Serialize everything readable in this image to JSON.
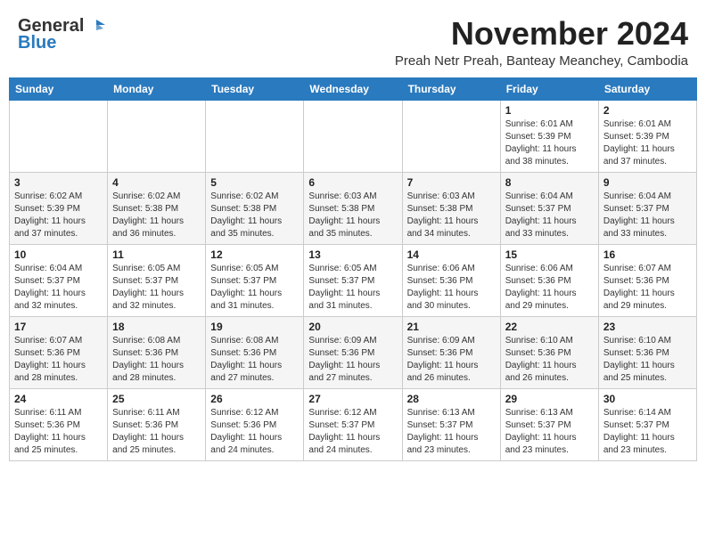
{
  "header": {
    "logo_line1": "General",
    "logo_line2": "Blue",
    "month": "November 2024",
    "subtitle": "Preah Netr Preah, Banteay Meanchey, Cambodia"
  },
  "weekdays": [
    "Sunday",
    "Monday",
    "Tuesday",
    "Wednesday",
    "Thursday",
    "Friday",
    "Saturday"
  ],
  "weeks": [
    [
      {
        "day": "",
        "info": ""
      },
      {
        "day": "",
        "info": ""
      },
      {
        "day": "",
        "info": ""
      },
      {
        "day": "",
        "info": ""
      },
      {
        "day": "",
        "info": ""
      },
      {
        "day": "1",
        "info": "Sunrise: 6:01 AM\nSunset: 5:39 PM\nDaylight: 11 hours and 38 minutes."
      },
      {
        "day": "2",
        "info": "Sunrise: 6:01 AM\nSunset: 5:39 PM\nDaylight: 11 hours and 37 minutes."
      }
    ],
    [
      {
        "day": "3",
        "info": "Sunrise: 6:02 AM\nSunset: 5:39 PM\nDaylight: 11 hours and 37 minutes."
      },
      {
        "day": "4",
        "info": "Sunrise: 6:02 AM\nSunset: 5:38 PM\nDaylight: 11 hours and 36 minutes."
      },
      {
        "day": "5",
        "info": "Sunrise: 6:02 AM\nSunset: 5:38 PM\nDaylight: 11 hours and 35 minutes."
      },
      {
        "day": "6",
        "info": "Sunrise: 6:03 AM\nSunset: 5:38 PM\nDaylight: 11 hours and 35 minutes."
      },
      {
        "day": "7",
        "info": "Sunrise: 6:03 AM\nSunset: 5:38 PM\nDaylight: 11 hours and 34 minutes."
      },
      {
        "day": "8",
        "info": "Sunrise: 6:04 AM\nSunset: 5:37 PM\nDaylight: 11 hours and 33 minutes."
      },
      {
        "day": "9",
        "info": "Sunrise: 6:04 AM\nSunset: 5:37 PM\nDaylight: 11 hours and 33 minutes."
      }
    ],
    [
      {
        "day": "10",
        "info": "Sunrise: 6:04 AM\nSunset: 5:37 PM\nDaylight: 11 hours and 32 minutes."
      },
      {
        "day": "11",
        "info": "Sunrise: 6:05 AM\nSunset: 5:37 PM\nDaylight: 11 hours and 32 minutes."
      },
      {
        "day": "12",
        "info": "Sunrise: 6:05 AM\nSunset: 5:37 PM\nDaylight: 11 hours and 31 minutes."
      },
      {
        "day": "13",
        "info": "Sunrise: 6:05 AM\nSunset: 5:37 PM\nDaylight: 11 hours and 31 minutes."
      },
      {
        "day": "14",
        "info": "Sunrise: 6:06 AM\nSunset: 5:36 PM\nDaylight: 11 hours and 30 minutes."
      },
      {
        "day": "15",
        "info": "Sunrise: 6:06 AM\nSunset: 5:36 PM\nDaylight: 11 hours and 29 minutes."
      },
      {
        "day": "16",
        "info": "Sunrise: 6:07 AM\nSunset: 5:36 PM\nDaylight: 11 hours and 29 minutes."
      }
    ],
    [
      {
        "day": "17",
        "info": "Sunrise: 6:07 AM\nSunset: 5:36 PM\nDaylight: 11 hours and 28 minutes."
      },
      {
        "day": "18",
        "info": "Sunrise: 6:08 AM\nSunset: 5:36 PM\nDaylight: 11 hours and 28 minutes."
      },
      {
        "day": "19",
        "info": "Sunrise: 6:08 AM\nSunset: 5:36 PM\nDaylight: 11 hours and 27 minutes."
      },
      {
        "day": "20",
        "info": "Sunrise: 6:09 AM\nSunset: 5:36 PM\nDaylight: 11 hours and 27 minutes."
      },
      {
        "day": "21",
        "info": "Sunrise: 6:09 AM\nSunset: 5:36 PM\nDaylight: 11 hours and 26 minutes."
      },
      {
        "day": "22",
        "info": "Sunrise: 6:10 AM\nSunset: 5:36 PM\nDaylight: 11 hours and 26 minutes."
      },
      {
        "day": "23",
        "info": "Sunrise: 6:10 AM\nSunset: 5:36 PM\nDaylight: 11 hours and 25 minutes."
      }
    ],
    [
      {
        "day": "24",
        "info": "Sunrise: 6:11 AM\nSunset: 5:36 PM\nDaylight: 11 hours and 25 minutes."
      },
      {
        "day": "25",
        "info": "Sunrise: 6:11 AM\nSunset: 5:36 PM\nDaylight: 11 hours and 25 minutes."
      },
      {
        "day": "26",
        "info": "Sunrise: 6:12 AM\nSunset: 5:36 PM\nDaylight: 11 hours and 24 minutes."
      },
      {
        "day": "27",
        "info": "Sunrise: 6:12 AM\nSunset: 5:37 PM\nDaylight: 11 hours and 24 minutes."
      },
      {
        "day": "28",
        "info": "Sunrise: 6:13 AM\nSunset: 5:37 PM\nDaylight: 11 hours and 23 minutes."
      },
      {
        "day": "29",
        "info": "Sunrise: 6:13 AM\nSunset: 5:37 PM\nDaylight: 11 hours and 23 minutes."
      },
      {
        "day": "30",
        "info": "Sunrise: 6:14 AM\nSunset: 5:37 PM\nDaylight: 11 hours and 23 minutes."
      }
    ]
  ]
}
